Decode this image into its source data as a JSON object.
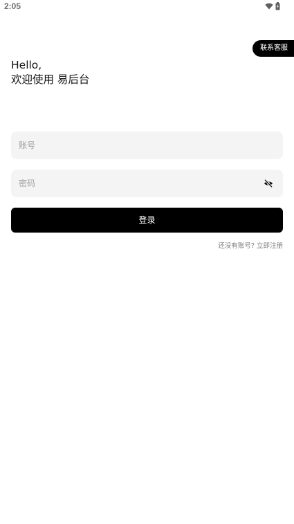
{
  "status_bar": {
    "time": "2:05",
    "icons": [
      "wifi-icon",
      "battery-icon"
    ]
  },
  "contact": {
    "label": "联系客服"
  },
  "greeting": {
    "line1": "Hello,",
    "line2": "欢迎使用 易后台"
  },
  "form": {
    "account": {
      "placeholder": "账号",
      "value": ""
    },
    "password": {
      "placeholder": "密码",
      "value": "",
      "toggle_icon": "eye-off-icon"
    },
    "login_label": "登录"
  },
  "register": {
    "prompt": "还没有账号?",
    "link": "立即注册"
  },
  "colors": {
    "primary": "#000000",
    "input_bg": "#f4f4f4",
    "muted_text": "#808080",
    "placeholder": "#a0a0a0"
  }
}
